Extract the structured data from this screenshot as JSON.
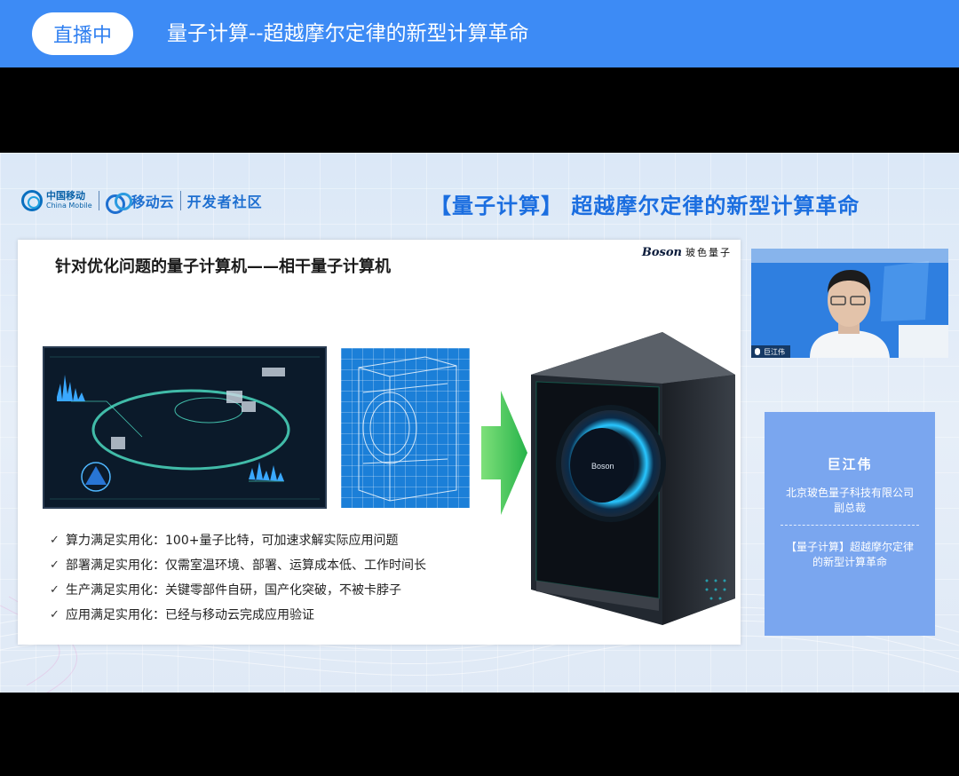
{
  "topbar": {
    "live_label": "直播中",
    "title": "量子计算--超越摩尔定律的新型计算革命"
  },
  "branding": {
    "cm_cn": "中国移动",
    "cm_en": "China Mobile",
    "cloud": "移动云",
    "community": "开发者社区",
    "banner_bracket": "【量子计算】",
    "banner_title": "超越摩尔定律的新型计算革命"
  },
  "slide": {
    "title": "针对优化问题的量子计算机——相干量子计算机",
    "logo_mark": "Boson",
    "logo_cn": "玻色量子",
    "machine_brand": "Boson",
    "bullets": [
      "算力满足实用化：100+量子比特，可加速求解实际应用问题",
      "部署满足实用化：仅需室温环境、部署、运算成本低、工作时间长",
      "生产满足实用化：关键零部件自研，国产化突破，不被卡脖子",
      "应用满足实用化：已经与移动云完成应用验证"
    ]
  },
  "presenter": {
    "cam_name": "巨江伟",
    "name": "巨江伟",
    "company": "北京玻色量子科技有限公司",
    "role": "副总裁",
    "topic": "【量子计算】超越摩尔定律的新型计算革命"
  },
  "colors": {
    "topbar": "#3d8bf5",
    "banner": "#1b6ee0",
    "info_card": "#7aa6ef"
  }
}
